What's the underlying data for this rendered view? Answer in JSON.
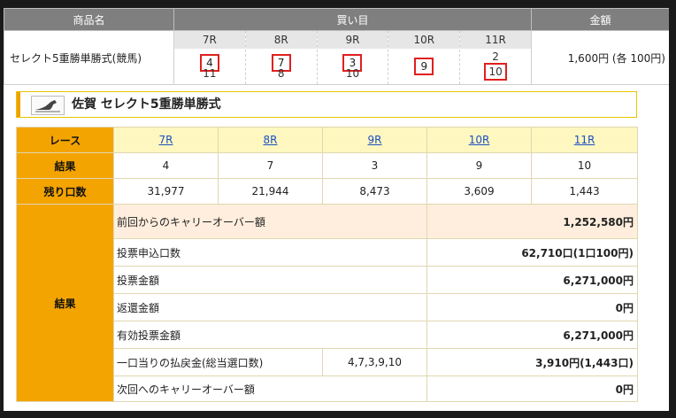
{
  "purchase": {
    "headers": {
      "product": "商品名",
      "picks": "買い目",
      "amount": "金額"
    },
    "product_name": "セレクト5重勝単勝式(競馬)",
    "amount": "1,600円 (各 100円)",
    "picks": [
      {
        "race": "7R",
        "main": "4",
        "sub": "11"
      },
      {
        "race": "8R",
        "main": "7",
        "sub": "8"
      },
      {
        "race": "9R",
        "main": "3",
        "sub": "10"
      },
      {
        "race": "10R",
        "main": "9",
        "sub": ""
      },
      {
        "race": "11R",
        "main": "2",
        "sub": "10"
      }
    ]
  },
  "header_bar": {
    "title": "佐賀 セレクト5重勝単勝式",
    "logo": "horse-logo-icon"
  },
  "result": {
    "race_label": "レース",
    "races": [
      "7R",
      "8R",
      "9R",
      "10R",
      "11R"
    ],
    "result_label": "結果",
    "results": [
      "4",
      "7",
      "3",
      "9",
      "10"
    ],
    "remaining_label": "残り口数",
    "remaining": [
      "31,977",
      "21,944",
      "8,473",
      "3,609",
      "1,443"
    ],
    "summary_label": "結果",
    "rows": [
      {
        "label": "前回からのキャリーオーバー額",
        "value": "1,252,580円"
      },
      {
        "label": "投票申込口数",
        "value": "62,710口(1口100円)"
      },
      {
        "label": "投票金額",
        "value": "6,271,000円"
      },
      {
        "label": "返還金額",
        "value": "0円"
      },
      {
        "label": "有効投票金額",
        "value": "6,271,000円"
      },
      {
        "label": "一口当りの払戻金(総当選口数)",
        "combo": "4,7,3,9,10",
        "value": "3,910円(1,443口)"
      },
      {
        "label": "次回へのキャリーオーバー額",
        "value": "0円"
      }
    ]
  },
  "colors": {
    "header_gray": "#7f7f7f",
    "orange": "#f4a400",
    "race_bg": "#fff7c0",
    "highlight_red": "#e0201e",
    "link": "#1a4fc4"
  }
}
